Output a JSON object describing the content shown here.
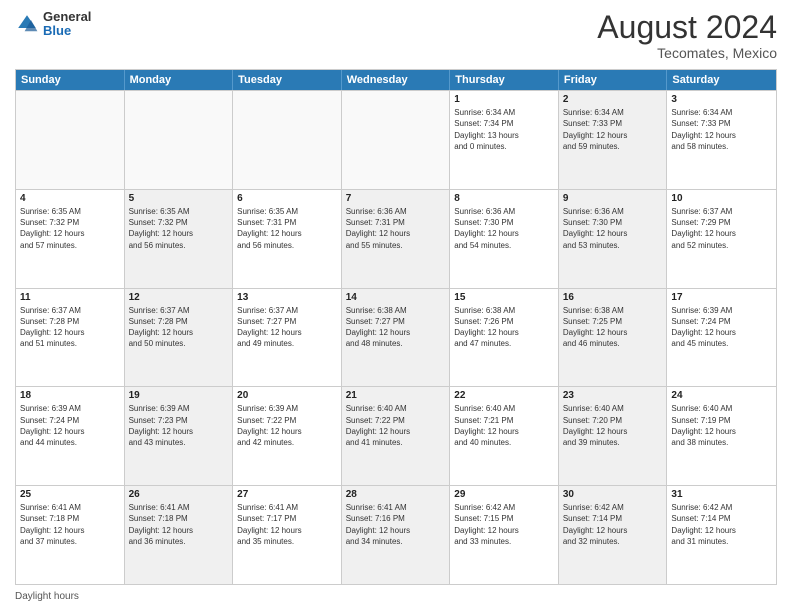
{
  "header": {
    "logo_general": "General",
    "logo_blue": "Blue",
    "main_title": "August 2024",
    "subtitle": "Tecomates, Mexico"
  },
  "calendar": {
    "days_of_week": [
      "Sunday",
      "Monday",
      "Tuesday",
      "Wednesday",
      "Thursday",
      "Friday",
      "Saturday"
    ],
    "weeks": [
      [
        {
          "day": "",
          "info": "",
          "shaded": true
        },
        {
          "day": "",
          "info": "",
          "shaded": true
        },
        {
          "day": "",
          "info": "",
          "shaded": true
        },
        {
          "day": "",
          "info": "",
          "shaded": true
        },
        {
          "day": "1",
          "info": "Sunrise: 6:34 AM\nSunset: 7:34 PM\nDaylight: 13 hours\nand 0 minutes.",
          "shaded": false
        },
        {
          "day": "2",
          "info": "Sunrise: 6:34 AM\nSunset: 7:33 PM\nDaylight: 12 hours\nand 59 minutes.",
          "shaded": true
        },
        {
          "day": "3",
          "info": "Sunrise: 6:34 AM\nSunset: 7:33 PM\nDaylight: 12 hours\nand 58 minutes.",
          "shaded": false
        }
      ],
      [
        {
          "day": "4",
          "info": "Sunrise: 6:35 AM\nSunset: 7:32 PM\nDaylight: 12 hours\nand 57 minutes.",
          "shaded": false
        },
        {
          "day": "5",
          "info": "Sunrise: 6:35 AM\nSunset: 7:32 PM\nDaylight: 12 hours\nand 56 minutes.",
          "shaded": true
        },
        {
          "day": "6",
          "info": "Sunrise: 6:35 AM\nSunset: 7:31 PM\nDaylight: 12 hours\nand 56 minutes.",
          "shaded": false
        },
        {
          "day": "7",
          "info": "Sunrise: 6:36 AM\nSunset: 7:31 PM\nDaylight: 12 hours\nand 55 minutes.",
          "shaded": true
        },
        {
          "day": "8",
          "info": "Sunrise: 6:36 AM\nSunset: 7:30 PM\nDaylight: 12 hours\nand 54 minutes.",
          "shaded": false
        },
        {
          "day": "9",
          "info": "Sunrise: 6:36 AM\nSunset: 7:30 PM\nDaylight: 12 hours\nand 53 minutes.",
          "shaded": true
        },
        {
          "day": "10",
          "info": "Sunrise: 6:37 AM\nSunset: 7:29 PM\nDaylight: 12 hours\nand 52 minutes.",
          "shaded": false
        }
      ],
      [
        {
          "day": "11",
          "info": "Sunrise: 6:37 AM\nSunset: 7:28 PM\nDaylight: 12 hours\nand 51 minutes.",
          "shaded": false
        },
        {
          "day": "12",
          "info": "Sunrise: 6:37 AM\nSunset: 7:28 PM\nDaylight: 12 hours\nand 50 minutes.",
          "shaded": true
        },
        {
          "day": "13",
          "info": "Sunrise: 6:37 AM\nSunset: 7:27 PM\nDaylight: 12 hours\nand 49 minutes.",
          "shaded": false
        },
        {
          "day": "14",
          "info": "Sunrise: 6:38 AM\nSunset: 7:27 PM\nDaylight: 12 hours\nand 48 minutes.",
          "shaded": true
        },
        {
          "day": "15",
          "info": "Sunrise: 6:38 AM\nSunset: 7:26 PM\nDaylight: 12 hours\nand 47 minutes.",
          "shaded": false
        },
        {
          "day": "16",
          "info": "Sunrise: 6:38 AM\nSunset: 7:25 PM\nDaylight: 12 hours\nand 46 minutes.",
          "shaded": true
        },
        {
          "day": "17",
          "info": "Sunrise: 6:39 AM\nSunset: 7:24 PM\nDaylight: 12 hours\nand 45 minutes.",
          "shaded": false
        }
      ],
      [
        {
          "day": "18",
          "info": "Sunrise: 6:39 AM\nSunset: 7:24 PM\nDaylight: 12 hours\nand 44 minutes.",
          "shaded": false
        },
        {
          "day": "19",
          "info": "Sunrise: 6:39 AM\nSunset: 7:23 PM\nDaylight: 12 hours\nand 43 minutes.",
          "shaded": true
        },
        {
          "day": "20",
          "info": "Sunrise: 6:39 AM\nSunset: 7:22 PM\nDaylight: 12 hours\nand 42 minutes.",
          "shaded": false
        },
        {
          "day": "21",
          "info": "Sunrise: 6:40 AM\nSunset: 7:22 PM\nDaylight: 12 hours\nand 41 minutes.",
          "shaded": true
        },
        {
          "day": "22",
          "info": "Sunrise: 6:40 AM\nSunset: 7:21 PM\nDaylight: 12 hours\nand 40 minutes.",
          "shaded": false
        },
        {
          "day": "23",
          "info": "Sunrise: 6:40 AM\nSunset: 7:20 PM\nDaylight: 12 hours\nand 39 minutes.",
          "shaded": true
        },
        {
          "day": "24",
          "info": "Sunrise: 6:40 AM\nSunset: 7:19 PM\nDaylight: 12 hours\nand 38 minutes.",
          "shaded": false
        }
      ],
      [
        {
          "day": "25",
          "info": "Sunrise: 6:41 AM\nSunset: 7:18 PM\nDaylight: 12 hours\nand 37 minutes.",
          "shaded": false
        },
        {
          "day": "26",
          "info": "Sunrise: 6:41 AM\nSunset: 7:18 PM\nDaylight: 12 hours\nand 36 minutes.",
          "shaded": true
        },
        {
          "day": "27",
          "info": "Sunrise: 6:41 AM\nSunset: 7:17 PM\nDaylight: 12 hours\nand 35 minutes.",
          "shaded": false
        },
        {
          "day": "28",
          "info": "Sunrise: 6:41 AM\nSunset: 7:16 PM\nDaylight: 12 hours\nand 34 minutes.",
          "shaded": true
        },
        {
          "day": "29",
          "info": "Sunrise: 6:42 AM\nSunset: 7:15 PM\nDaylight: 12 hours\nand 33 minutes.",
          "shaded": false
        },
        {
          "day": "30",
          "info": "Sunrise: 6:42 AM\nSunset: 7:14 PM\nDaylight: 12 hours\nand 32 minutes.",
          "shaded": true
        },
        {
          "day": "31",
          "info": "Sunrise: 6:42 AM\nSunset: 7:14 PM\nDaylight: 12 hours\nand 31 minutes.",
          "shaded": false
        }
      ]
    ]
  },
  "footer": {
    "text": "Daylight hours"
  }
}
